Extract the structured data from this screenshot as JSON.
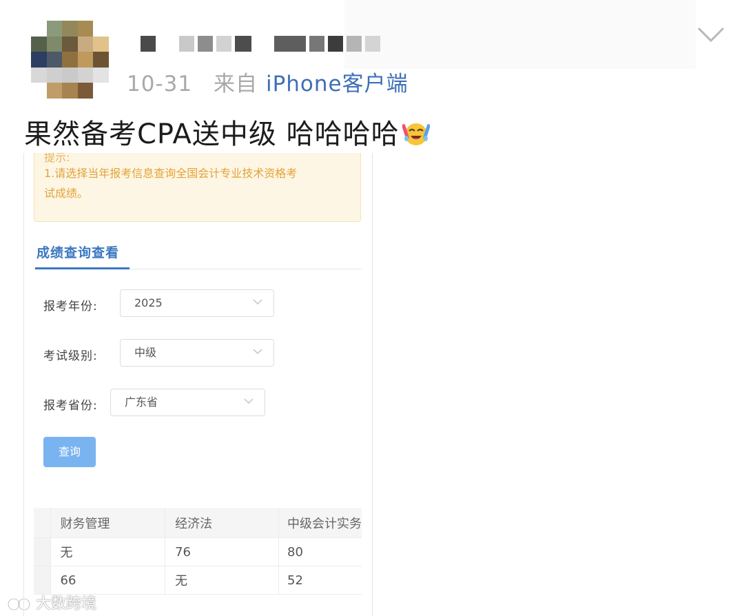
{
  "post": {
    "meta": "10-31",
    "source_prefix": "来自",
    "source_client": "iPhone客户端",
    "text": "果然备考CPA送中级 哈哈哈哈",
    "emoji": "crying-laughing-emoji"
  },
  "embedded": {
    "notice_cut": "提示:",
    "notice_line1": "1.请选择当年报考信息查询全国会计专业技术资格考",
    "notice_line2": "试成绩。",
    "tab_label": "成绩查询查看",
    "fields": {
      "year_label": "报考年份:",
      "year_value": "2025",
      "level_label": "考试级别:",
      "level_value": "中级",
      "province_label": "报考省份:",
      "province_value": "广东省"
    },
    "query_button": "查询",
    "table": {
      "headers": [
        "财务管理",
        "经济法",
        "中级会计实务"
      ],
      "rows": [
        [
          "无",
          "76",
          "80"
        ],
        [
          "66",
          "无",
          "52"
        ]
      ]
    }
  },
  "watermark": "大数跨境",
  "colors": {
    "link_blue": "#3d6fb8",
    "tab_blue": "#3a78c2",
    "notice_bg": "#fdf6e4",
    "notice_text": "#e3a33a",
    "button_blue": "#79b3f0"
  }
}
